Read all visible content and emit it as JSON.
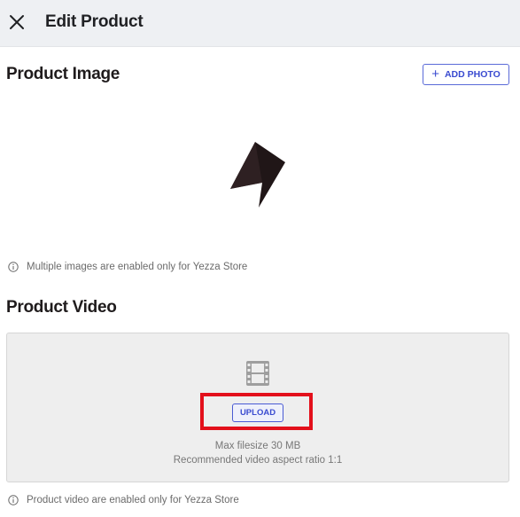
{
  "header": {
    "title": "Edit Product",
    "close_icon": "close-icon"
  },
  "image_section": {
    "title": "Product Image",
    "add_photo_label": "ADD PHOTO",
    "add_photo_icon": "plus-icon",
    "image_icon": "lightning-bolt-logo",
    "note": "Multiple images are enabled only for Yezza Store"
  },
  "video_section": {
    "title": "Product Video",
    "placeholder_icon": "film-icon",
    "upload_label": "UPLOAD",
    "max_filesize": "Max filesize 30 MB",
    "aspect_ratio": "Recommended video aspect ratio 1:1",
    "note": "Product video are enabled only for Yezza Store"
  },
  "colors": {
    "accent": "#3a4bd0",
    "highlight": "#e3101b",
    "header_bg": "#eef0f3"
  }
}
